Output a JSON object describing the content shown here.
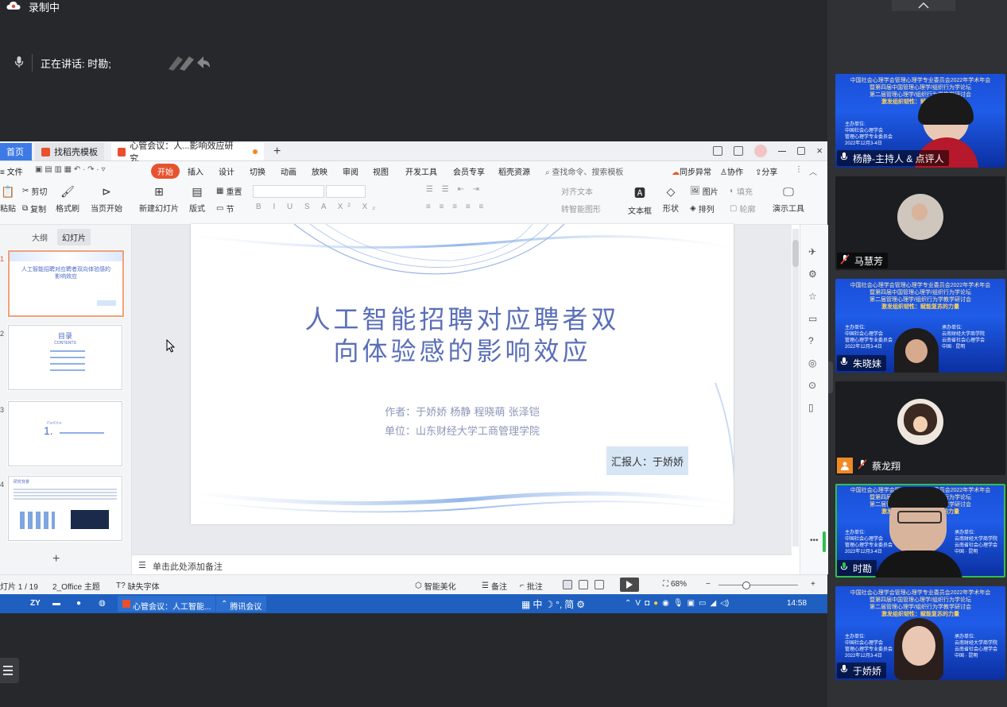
{
  "overlay": {
    "recording_label": "录制中",
    "speaking_label": "正在讲话: 时勘;"
  },
  "participants": [
    {
      "name": "杨静-主持人 & 点评人",
      "muted": false
    },
    {
      "name": "马慧芳",
      "muted": true
    },
    {
      "name": "朱晓妹",
      "muted": false
    },
    {
      "name": "蔡龙翔",
      "muted": true
    },
    {
      "name": "时勘",
      "muted": false,
      "speaking": true
    },
    {
      "name": "于娇娇",
      "muted": false
    }
  ],
  "meeting_banner": {
    "line1": "中国社会心理学会管理心理学专业委员会2022年学术年会",
    "line2": "暨第四届中国管理心理学/组织行为学论坛",
    "line3": "第二届管理心理学/组织行为学教学研讨会",
    "line4": "激发组织韧性：赋能复苏的力量",
    "host_label": "主办单位:",
    "org_label": "承办单位:",
    "host1": "中国社会心理学会",
    "host2": "管理心理学专业委员会",
    "org1": "云南财经大学商学院",
    "org2": "云南省社会心理学会",
    "date": "2022年12月3-4日",
    "place": "中国 · 昆明"
  },
  "wps": {
    "tabs": {
      "home": "首页",
      "template": "找稻壳模板",
      "doc": "心管会议：人...影响效应研究"
    },
    "menu": {
      "file": "文件",
      "start": "开始",
      "insert": "插入",
      "design": "设计",
      "switch": "切换",
      "animation": "动画",
      "show": "放映",
      "review": "审阅",
      "view": "视图",
      "devtools": "开发工具",
      "member": "会员专享",
      "resources": "稻壳资源",
      "search": "查找命令、搜索模板",
      "sync": "同步异常",
      "collab": "协作",
      "share": "分享"
    },
    "ribbon": {
      "paste": "粘贴",
      "cut": "剪切",
      "copy": "复制",
      "format_painter": "格式刷",
      "from_current": "当页开始",
      "new_slide": "新建幻灯片",
      "layout": "版式",
      "section": "节",
      "reset": "重置",
      "align_text": "对齐文本",
      "smart_art": "转智能图形",
      "textbox": "文本框",
      "shape": "形状",
      "picture": "图片",
      "fill": "填充",
      "arrange": "排列",
      "outline": "轮廓",
      "present_tools": "演示工具"
    },
    "pane_tabs": {
      "outline": "大纲",
      "slides": "幻灯片"
    },
    "slide": {
      "title_line1": "人工智能招聘对应聘者双",
      "title_line2": "向体验感的影响效应",
      "authors": "作者：于娇娇  杨静  程晓萌  张泽铠",
      "affiliation": "单位：山东财经大学工商管理学院",
      "presenter": "汇报人：于娇娇"
    },
    "thumbs": {
      "t1_title": "人工智能招聘对应聘者双向体验感的影响效应",
      "t2_title": "目录",
      "t2_sub": "CONTENTS",
      "t3_num": "1.",
      "t3_part": "PartOne",
      "t4_title": "研究背景"
    },
    "notes_placeholder": "单击此处添加备注",
    "status": {
      "slide_counter": "灯片 1 / 19",
      "theme": "2_Office 主题",
      "missing_font": "缺失字体",
      "beautify": "智能美化",
      "notes": "备注",
      "comments": "批注",
      "zoom": "68%"
    },
    "taskbar": {
      "app1": "心管会议：人工智能...",
      "app2": "腾讯会议",
      "ime": "中",
      "simplified": "简",
      "time": "14:58"
    }
  },
  "colors": {
    "slide_title": "#5a6fb8",
    "accent_orange": "#e6542f",
    "taskbar": "#1e5fbf",
    "meeting_bg": "#26282c"
  }
}
